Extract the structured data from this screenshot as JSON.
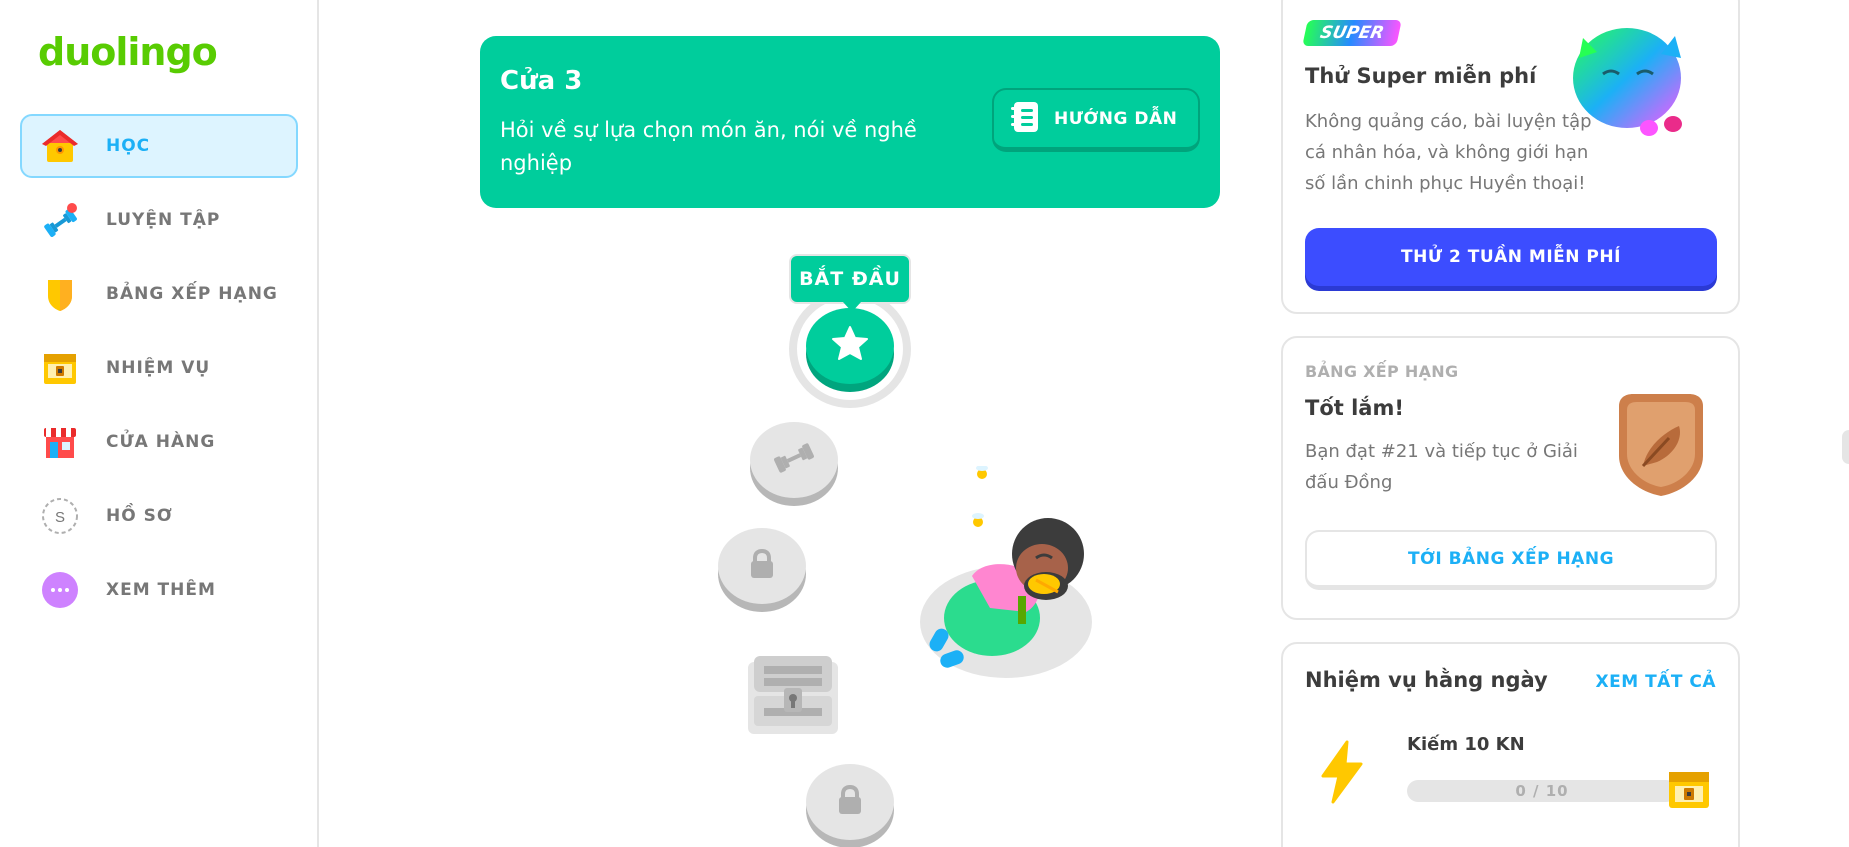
{
  "app": {
    "logo": "duolingo",
    "colors": {
      "brand": "#58cc02",
      "accent": "#1cb0f6",
      "unit": "#00cd9c",
      "super_button": "#3c4dff"
    }
  },
  "sidebar": {
    "items": [
      {
        "label": "HỌC",
        "icon": "home-icon",
        "active": true
      },
      {
        "label": "LUYỆN TẬP",
        "icon": "dumbbell-icon",
        "active": false
      },
      {
        "label": "BẢNG XẾP HẠNG",
        "icon": "shield-icon",
        "active": false
      },
      {
        "label": "NHIỆM VỤ",
        "icon": "treasure-chest-icon",
        "active": false
      },
      {
        "label": "CỬA HÀNG",
        "icon": "shop-icon",
        "active": false
      },
      {
        "label": "HỒ SƠ",
        "icon": "profile-avatar-icon",
        "active": false
      },
      {
        "label": "XEM THÊM",
        "icon": "more-dots-icon",
        "active": false
      }
    ],
    "profile_initial": "S"
  },
  "unit": {
    "title": "Cửa 3",
    "subtitle": "Hỏi về sự lựa chọn món ăn, nói về nghề nghiệp",
    "guide_button": "HƯỚNG DẪN"
  },
  "path": {
    "start_label": "BẮT ĐẦU",
    "nodes": [
      "star-lesson-icon",
      "practice-dumbbell-icon",
      "lock-icon",
      "treasure-chest-icon",
      "lock-icon"
    ]
  },
  "super_card": {
    "badge": "SUPER",
    "title": "Thử Super miễn phí",
    "text": "Không quảng cáo, bài luyện tập cá nhân hóa, và không giới hạn số lần chinh phục Huyền thoại!",
    "button": "THỬ 2 TUẦN MIỄN PHÍ"
  },
  "league_card": {
    "heading": "BẢNG XẾP HẠNG",
    "title": "Tốt lắm!",
    "text": "Bạn đạt #21 và tiếp tục ở Giải đấu Đồng",
    "button": "TỚI BẢNG XẾP HẠNG"
  },
  "quests_card": {
    "title": "Nhiệm vụ hằng ngày",
    "view_all": "XEM TẤT CẢ",
    "quest": {
      "label": "Kiếm 10 KN",
      "progress_text": "0 / 10",
      "progress": 0.0
    }
  }
}
